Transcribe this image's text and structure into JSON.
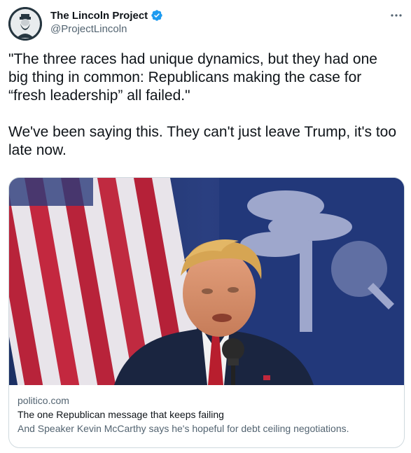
{
  "author": {
    "display_name": "The Lincoln Project",
    "handle": "@ProjectLincoln",
    "verified": true,
    "avatar": "lincoln-portrait"
  },
  "tweet": {
    "text": "\"The three races had unique dynamics, but they had one big thing in common: Republicans making the case for “fresh leadership” all failed.\"\n\nWe've been saying this. They can't just leave Trump, it's too late now."
  },
  "link_card": {
    "domain": "politico.com",
    "title": "The one Republican message that keeps failing",
    "description": "And Speaker Kevin McCarthy says he's hopeful for debt ceiling negotiations.",
    "image": "photo-speaker-at-podium-with-flags"
  },
  "icons": {
    "verified": "verified-badge-icon",
    "more": "more-options-icon"
  },
  "colors": {
    "text_primary": "#0f1419",
    "text_secondary": "#536471",
    "verified_blue": "#1d9bf0",
    "card_border": "#cfd9de"
  }
}
